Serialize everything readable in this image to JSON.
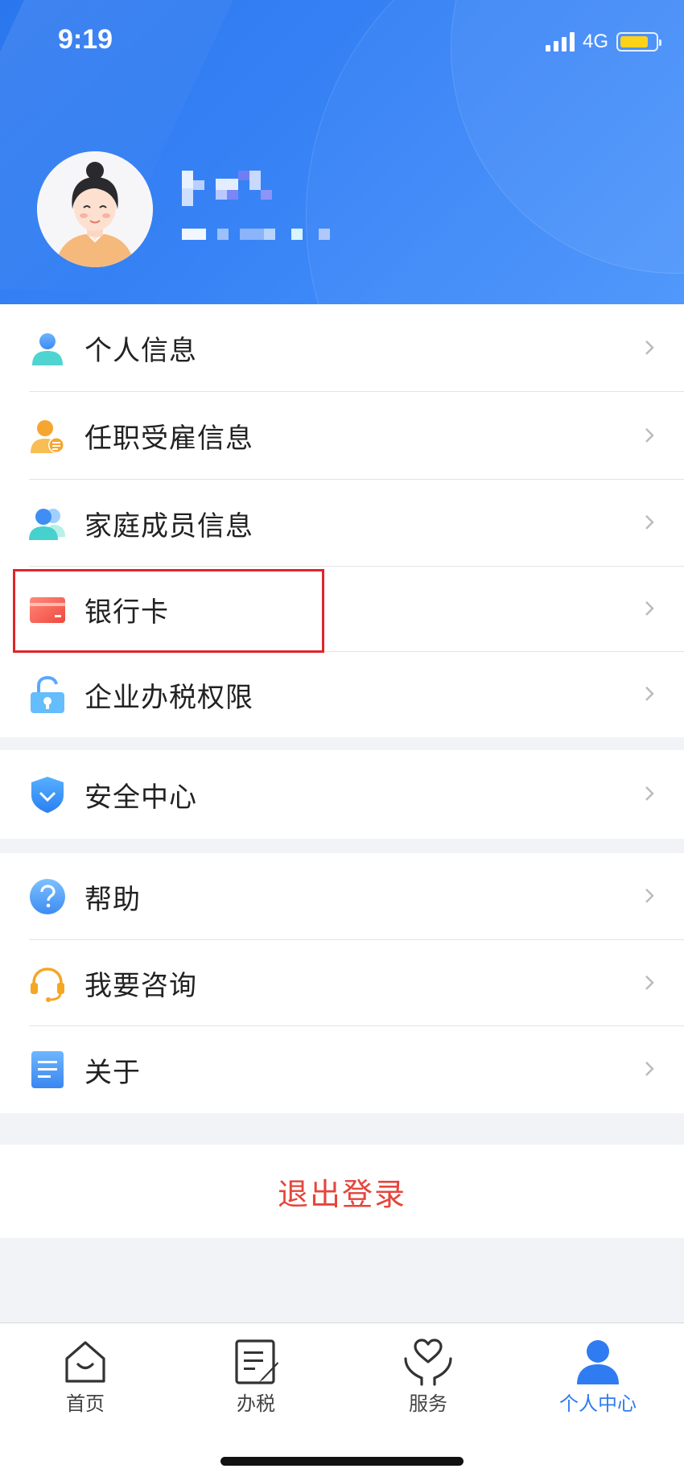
{
  "status_bar": {
    "time": "9:19",
    "network": "4G",
    "battery_level": 0.8
  },
  "profile": {
    "avatar_icon": "female-avatar-icon"
  },
  "menu_groups": [
    {
      "items": [
        {
          "label": "个人信息",
          "icon": "person-icon"
        },
        {
          "label": "任职受雇信息",
          "icon": "employment-info-icon"
        },
        {
          "label": "家庭成员信息",
          "icon": "family-members-icon"
        },
        {
          "label": "银行卡",
          "icon": "bank-card-icon"
        },
        {
          "label": "企业办税权限",
          "icon": "lock-key-icon"
        }
      ]
    },
    {
      "items": [
        {
          "label": "安全中心",
          "icon": "shield-icon"
        }
      ]
    },
    {
      "items": [
        {
          "label": "帮助",
          "icon": "help-icon"
        },
        {
          "label": "我要咨询",
          "icon": "headset-icon"
        },
        {
          "label": "关于",
          "icon": "document-icon"
        }
      ]
    }
  ],
  "logout": {
    "label": "退出登录"
  },
  "tab_bar": {
    "tabs": [
      {
        "label": "首页",
        "icon": "home-icon"
      },
      {
        "label": "办税",
        "icon": "tax-form-icon"
      },
      {
        "label": "服务",
        "icon": "service-heart-icon"
      },
      {
        "label": "个人中心",
        "icon": "profile-icon"
      }
    ],
    "active_index": 3
  },
  "colors": {
    "header_blue": "#2f7ef2",
    "accent_blue": "#2f7cf2",
    "logout_red": "#e4463c",
    "highlight_red": "#e0242b"
  }
}
